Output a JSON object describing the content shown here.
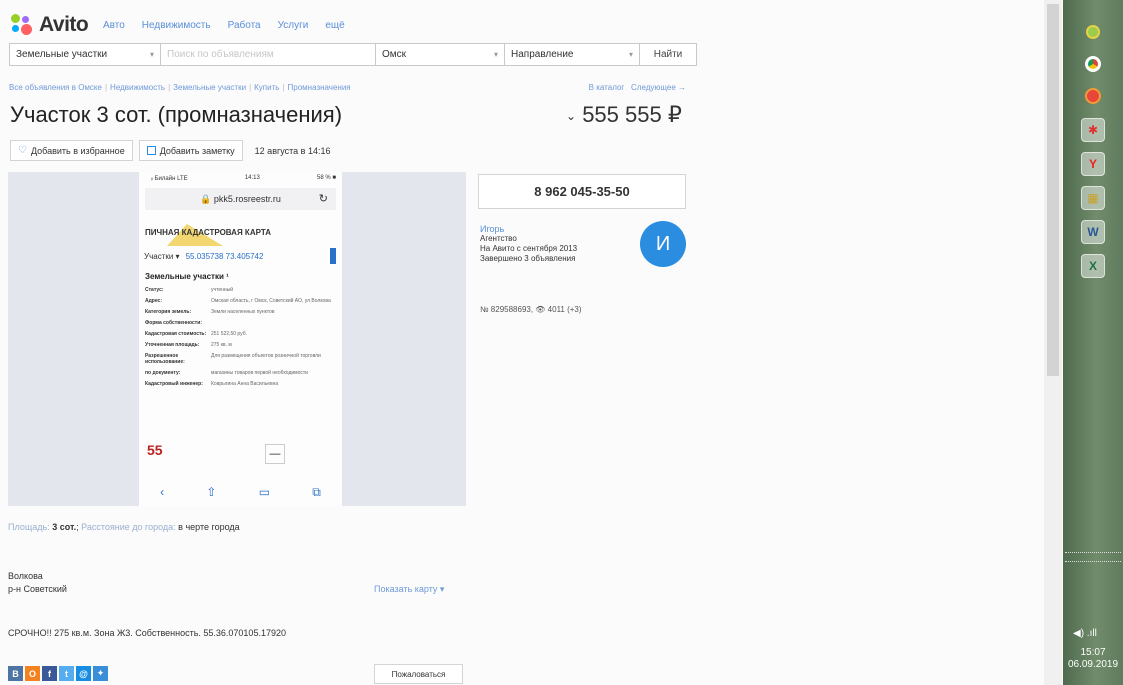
{
  "header": {
    "logo_text": "Avito",
    "nav": [
      "Авто",
      "Недвижимость",
      "Работа",
      "Услуги",
      "ещё"
    ]
  },
  "search": {
    "category": "Земельные участки",
    "query_placeholder": "Поиск по объявлениям",
    "city": "Омск",
    "direction": "Направление",
    "button": "Найти"
  },
  "breadcrumb": [
    "Все объявления в Омске",
    "Недвижимость",
    "Земельные участки",
    "Купить",
    "Промназначения"
  ],
  "catalog_links": {
    "catalog": "В каталог",
    "next": "Следующее →"
  },
  "listing": {
    "title": "Участок 3 сот. (промназначения)",
    "price": "555 555 ₽",
    "add_favorite": "Добавить в избранное",
    "add_note": "Добавить заметку",
    "date": "12 августа в 14:16"
  },
  "photo": {
    "status_left": "ᵢₗ Билайн LTE",
    "status_time": "14:13",
    "status_right": "58 % ■",
    "url": "🔒 pkk5.rosreestr.ru",
    "map_title": "ПИЧНАЯ КАДАСТРОВАЯ КАРТА",
    "coord_label": "Участки ▾",
    "coord_value": "55.035738 73.405742",
    "section_title": "Земельные участки ¹",
    "rows": [
      {
        "k": "Статус:",
        "v": "учтенный"
      },
      {
        "k": "Адрес:",
        "v": "Омская область, г Омск, Советский АО, ул Волкова"
      },
      {
        "k": "Категория земель:",
        "v": "Земли населенных пунктов"
      },
      {
        "k": "Форма собственности:",
        "v": ""
      },
      {
        "k": "Кадастровая стоимость:",
        "v": "251 522,50 руб."
      },
      {
        "k": "Уточненная площадь:",
        "v": "275 кв. м"
      },
      {
        "k": "Разрешенное использование:",
        "v": "Для размещения объектов розничной торговли"
      },
      {
        "k": "по документу:",
        "v": "магазины товаров первой необходимости"
      },
      {
        "k": "Кадастровый инженер:",
        "v": "Коврыгина Анна Васильевна"
      }
    ],
    "big_number": "55",
    "minus": "—"
  },
  "contact": {
    "phone": "8 962 045-35-50",
    "seller_name": "Игорь",
    "seller_type": "Агентство",
    "since": "На Авито с сентября 2013",
    "completed": "Завершено 3 объявления",
    "avatar_letter": "И",
    "ad_number": "№ 829588693,  👁 4011 (+3)"
  },
  "params": {
    "area_label": "Площадь:",
    "area_value": "3 сот.",
    "distance_label": "Расстояние до города:",
    "distance_value": "в черте города"
  },
  "address": {
    "street": "Волкова",
    "district": "р-н Советский",
    "show_map": "Показать карту ▾"
  },
  "description": "СРОЧНО!! 275 кв.м. Зона Ж3. Собственность. 55.36.070105.17920",
  "social": [
    "В",
    "О",
    "f",
    "t",
    "@",
    "✦"
  ],
  "complain": "Пожаловаться",
  "taskbar": {
    "time": "15:07",
    "date": "06.09.2019"
  },
  "colors": {
    "link": "#5a8fd8",
    "avatar": "#2a8de0",
    "taskbar": "#708c6b"
  }
}
